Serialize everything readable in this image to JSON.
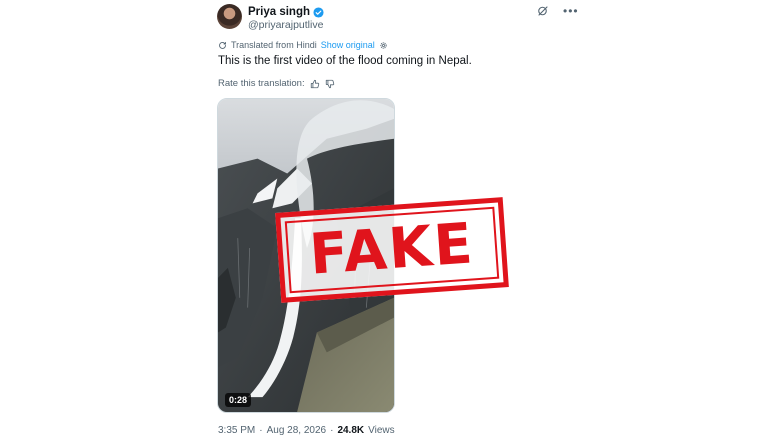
{
  "author": {
    "display_name": "Priya singh",
    "handle": "@priyarajputlive"
  },
  "translation": {
    "translated_label": "Translated from Hindi",
    "show_original_label": "Show original"
  },
  "tweet": {
    "text": "This is the first video of the flood coming in Nepal."
  },
  "rate": {
    "label": "Rate this translation:"
  },
  "media": {
    "duration": "0:28"
  },
  "overlay": {
    "stamp_text": "FAKE",
    "stamp_color": "#e0141c"
  },
  "meta": {
    "time": "3:35 PM",
    "separator": "·",
    "date": "Aug 28, 2026",
    "views_count": "24.8K",
    "views_label": "Views"
  },
  "colors": {
    "accent": "#1d9bf0",
    "muted": "#536471"
  }
}
